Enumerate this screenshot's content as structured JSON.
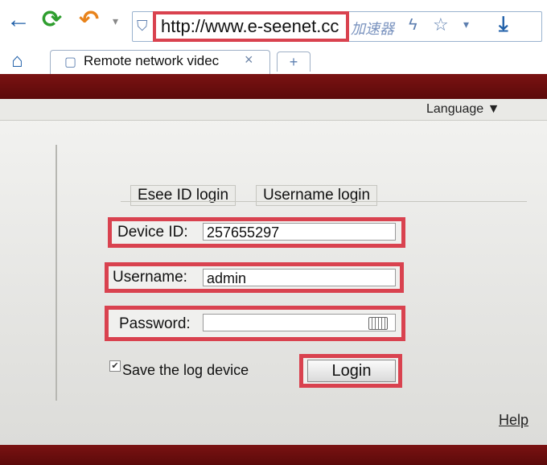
{
  "browser": {
    "url": "http://www.e-seenet.cc",
    "addon_text": "加速器",
    "tab_title": "Remote network videc",
    "tab_close": "×",
    "newtab": "+",
    "icons": [
      "back-arrow-icon",
      "refresh-icon",
      "undo-icon",
      "shield-icon",
      "lightning-icon",
      "star-icon",
      "dropdown-icon",
      "download-icon",
      "home-icon",
      "page-icon"
    ]
  },
  "page": {
    "language_label": "Language ▼",
    "tabs": [
      "Esee ID login",
      "Username login"
    ],
    "fields": {
      "device_id_label": "Device ID:",
      "device_id_value": "257655297",
      "username_label": "Username:",
      "username_value": "admin",
      "password_label": "Password:",
      "password_value": ""
    },
    "save_label": "Save the log device",
    "save_checked": true,
    "login_button": "Login",
    "help": "Help"
  },
  "colors": {
    "highlight": "#d9424f",
    "banner": "#6b0f0f",
    "browser_icon_blue": "#1f5fa8",
    "refresh_green": "#2f9e2f",
    "undo_orange": "#e8831b"
  }
}
